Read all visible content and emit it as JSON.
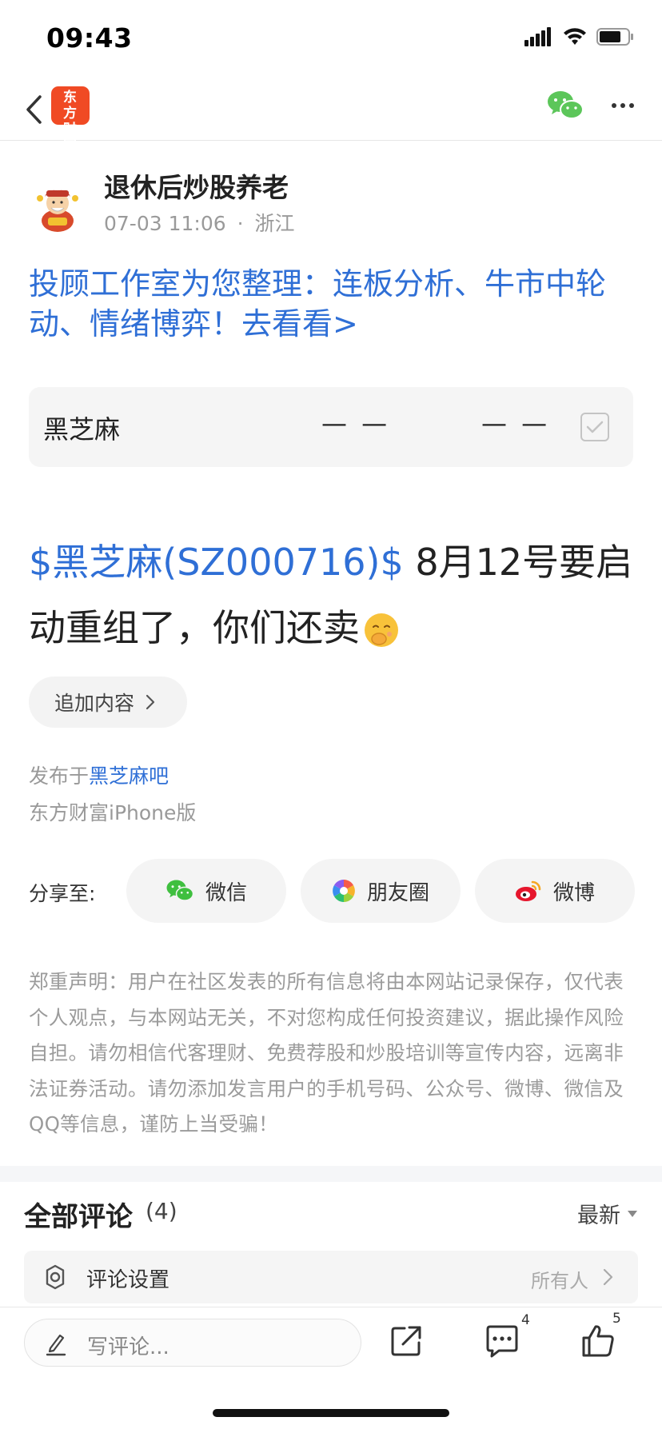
{
  "status_bar": {
    "time": "09:43"
  },
  "nav": {
    "logo_text": "东方财富"
  },
  "author": {
    "name": "退休后炒股养老",
    "date": "07-03 11:06",
    "location": "浙江",
    "separator": "·"
  },
  "promo_text": "投顾工作室为您整理：连板分析、牛市中轮动、情绪博弈！去看看>",
  "stock_card": {
    "name": "黑芝麻",
    "price": "— —",
    "change": "— —"
  },
  "post": {
    "stock_tag": "$黑芝麻(SZ000716)$",
    "text": " 8月12号要启动重组了，你们还卖"
  },
  "append_button": "追加内容",
  "publish": {
    "prefix": "发布于",
    "bar_name": "黑芝麻吧",
    "client": "东方财富iPhone版"
  },
  "share": {
    "label": "分享至:",
    "targets": [
      {
        "label": "微信",
        "icon": "wechat-icon"
      },
      {
        "label": "朋友圈",
        "icon": "moments-icon"
      },
      {
        "label": "微博",
        "icon": "weibo-icon"
      }
    ]
  },
  "disclaimer": "郑重声明：用户在社区发表的所有信息将由本网站记录保存，仅代表个人观点，与本网站无关，不对您构成任何投资建议，据此操作风险自担。请勿相信代客理财、免费荐股和炒股培训等宣传内容，远离非法证券活动。请勿添加发言用户的手机号码、公众号、微博、微信及QQ等信息，谨防上当受骗！",
  "comments": {
    "title": "全部评论",
    "count": "(4)",
    "sort": "最新",
    "settings_label": "评论设置",
    "settings_value": "所有人"
  },
  "bottom_bar": {
    "placeholder": "写评论...",
    "comment_count": "4",
    "like_count": "5"
  },
  "colors": {
    "link_blue": "#2f6fd6",
    "brand_red": "#f04a24",
    "wechat_green": "#3fbf3f"
  }
}
